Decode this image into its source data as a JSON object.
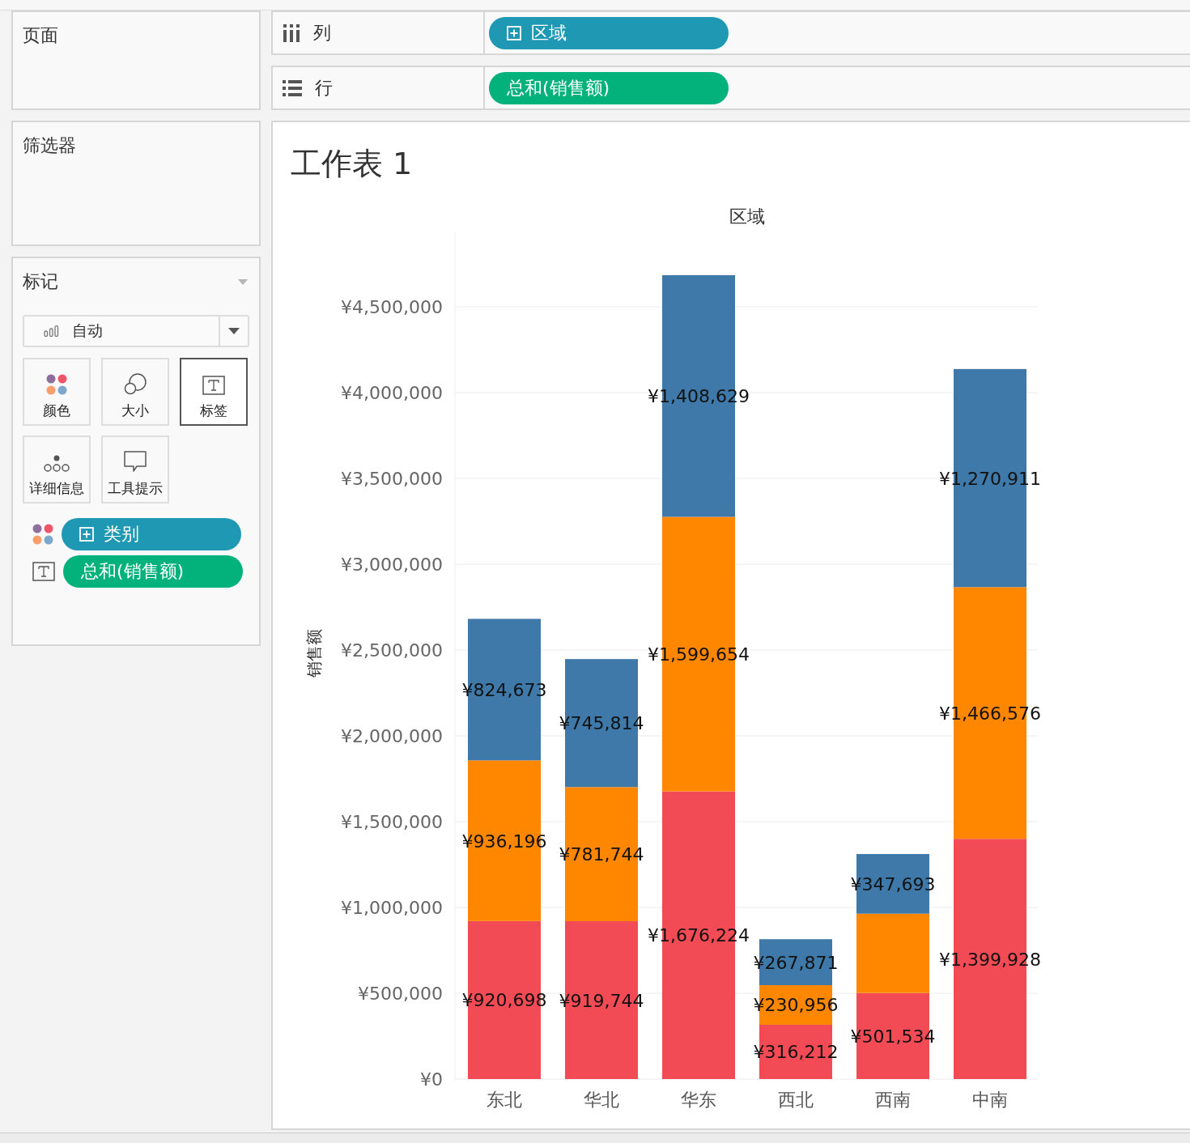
{
  "shelves": {
    "pages": {
      "title": "页面"
    },
    "filters": {
      "title": "筛选器"
    },
    "columns": {
      "label": "列",
      "kind": "columns",
      "pill": {
        "text": "区域",
        "color": "#1f98b4",
        "expandable": true
      }
    },
    "rows": {
      "label": "行",
      "kind": "rows",
      "pill": {
        "text": "总和(销售额)",
        "color": "#02b27a",
        "expandable": false
      }
    }
  },
  "marks": {
    "title": "标记",
    "mark_type": "自动",
    "cards": [
      {
        "label": "颜色",
        "kind": "color",
        "selected": false
      },
      {
        "label": "大小",
        "kind": "size",
        "selected": false
      },
      {
        "label": "标签",
        "kind": "label",
        "selected": true
      },
      {
        "label": "详细信息",
        "kind": "detail",
        "selected": false
      },
      {
        "label": "工具提示",
        "kind": "tooltip",
        "selected": false
      }
    ],
    "fields": [
      {
        "kind": "color",
        "color": "#1f98b4",
        "expandable": true,
        "text": "类别"
      },
      {
        "kind": "label",
        "color": "#02b27a",
        "expandable": false,
        "text": "总和(销售额)"
      }
    ]
  },
  "worksheet": {
    "title": "工作表 1",
    "chart_data": {
      "type": "bar",
      "stacked": true,
      "grid": true,
      "title": "区域",
      "ylabel": "销售额",
      "categories": [
        "东北",
        "华北",
        "华东",
        "西北",
        "西南",
        "中南"
      ],
      "series": [
        {
          "color": "#f24b55",
          "values": [
            920698,
            919744,
            1676224,
            316212,
            501534,
            1399928
          ],
          "value_labels": [
            "¥920,698",
            "¥919,744",
            "¥1,676,224",
            "¥316,212",
            "¥501,534",
            "¥1,399,928"
          ]
        },
        {
          "color": "#ff8700",
          "values": [
            936196,
            781744,
            1599654,
            230956,
            462000,
            1466576
          ],
          "value_labels": [
            "¥936,196",
            "¥781,744",
            "¥1,599,654",
            "¥230,956",
            null,
            "¥1,466,576"
          ]
        },
        {
          "color": "#3e79aa",
          "values": [
            824673,
            745814,
            1408629,
            267871,
            347693,
            1270911
          ],
          "value_labels": [
            "¥824,673",
            "¥745,814",
            "¥1,408,629",
            "¥267,871",
            "¥347,693",
            "¥1,270,911"
          ]
        }
      ],
      "ylim": [
        0,
        4934000
      ],
      "yticks": [
        {
          "value": 0,
          "label": "¥0"
        },
        {
          "value": 500000,
          "label": "¥500,000"
        },
        {
          "value": 1000000,
          "label": "¥1,000,000"
        },
        {
          "value": 1500000,
          "label": "¥1,500,000"
        },
        {
          "value": 2000000,
          "label": "¥2,000,000"
        },
        {
          "value": 2500000,
          "label": "¥2,500,000"
        },
        {
          "value": 3000000,
          "label": "¥3,000,000"
        },
        {
          "value": 3500000,
          "label": "¥3,500,000"
        },
        {
          "value": 4000000,
          "label": "¥4,000,000"
        },
        {
          "value": 4500000,
          "label": "¥4,500,000"
        }
      ]
    }
  }
}
